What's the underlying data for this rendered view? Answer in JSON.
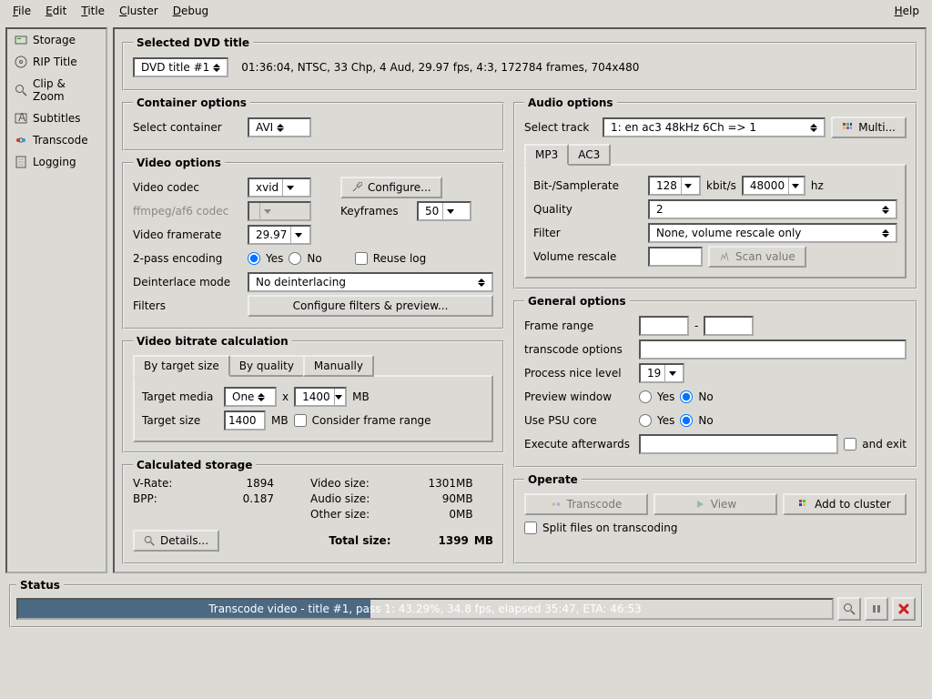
{
  "menu": {
    "file": "File",
    "edit": "Edit",
    "title": "Title",
    "cluster": "Cluster",
    "debug": "Debug",
    "help": "Help"
  },
  "sidebar": {
    "items": [
      {
        "label": "Storage"
      },
      {
        "label": "RIP Title"
      },
      {
        "label": "Clip & Zoom"
      },
      {
        "label": "Subtitles"
      },
      {
        "label": "Transcode"
      },
      {
        "label": "Logging"
      }
    ]
  },
  "selected": {
    "legend": "Selected DVD title",
    "dropdown": "DVD title #1",
    "info": "01:36:04, NTSC, 33 Chp, 4 Aud, 29.97 fps, 4:3, 172784 frames, 704x480"
  },
  "container": {
    "legend": "Container options",
    "label": "Select container",
    "value": "AVI"
  },
  "video": {
    "legend": "Video options",
    "codec_label": "Video codec",
    "codec": "xvid",
    "configure": "Configure...",
    "ffmpeg_label": "ffmpeg/af6 codec",
    "keyframes_label": "Keyframes",
    "keyframes": "50",
    "framerate_label": "Video framerate",
    "framerate": "29.97",
    "twopass_label": "2-pass encoding",
    "yes": "Yes",
    "no": "No",
    "reuse": "Reuse log",
    "deint_label": "Deinterlace mode",
    "deint": "No deinterlacing",
    "filters_label": "Filters",
    "filters_btn": "Configure filters & preview..."
  },
  "bitrate": {
    "legend": "Video bitrate calculation",
    "tabs": [
      "By target size",
      "By quality",
      "Manually"
    ],
    "target_media_label": "Target media",
    "target_media": "One",
    "x": "x",
    "disc": "1400",
    "mb": "MB",
    "target_size_label": "Target size",
    "target_size": "1400",
    "consider": "Consider frame range"
  },
  "calculated": {
    "legend": "Calculated storage",
    "vrate_label": "V-Rate:",
    "vrate": "1894",
    "bpp_label": "BPP:",
    "bpp": "0.187",
    "video_label": "Video size:",
    "video": "1301",
    "mb": "MB",
    "audio_label": "Audio size:",
    "audio": "90",
    "other_label": "Other size:",
    "other": "0",
    "total_label": "Total size:",
    "total": "1399",
    "details": "Details..."
  },
  "audio": {
    "legend": "Audio options",
    "track_label": "Select track",
    "track": "1: en ac3 48kHz 6Ch => 1",
    "multi": "Multi...",
    "tab_mp3": "MP3",
    "tab_ac3": "AC3",
    "bitrate_label": "Bit-/Samplerate",
    "bitrate": "128",
    "kbit": "kbit/s",
    "sample": "48000",
    "hz": "hz",
    "quality_label": "Quality",
    "quality": "2",
    "filter_label": "Filter",
    "filter": "None, volume rescale only",
    "volume_label": "Volume rescale",
    "scan": "Scan value"
  },
  "general": {
    "legend": "General options",
    "frame_label": "Frame range",
    "dash": "-",
    "tc_label": "transcode options",
    "nice_label": "Process nice level",
    "nice": "19",
    "preview_label": "Preview window",
    "yes": "Yes",
    "no": "No",
    "psu_label": "Use PSU core",
    "exec_label": "Execute afterwards",
    "and_exit": "and exit"
  },
  "operate": {
    "legend": "Operate",
    "transcode": "Transcode",
    "view": "View",
    "cluster": "Add to cluster",
    "split": "Split files on transcoding"
  },
  "status": {
    "legend": "Status",
    "text": "Transcode video - title #1, pass 1: 43.29%, 34.8 fps, elapsed 35:47, ETA: 46:53",
    "percent": 43.29
  }
}
